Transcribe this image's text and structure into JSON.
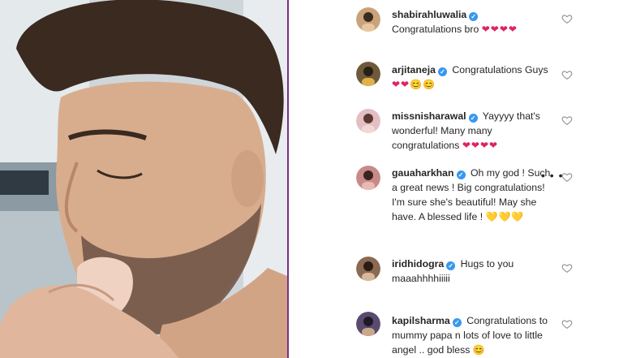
{
  "comments": [
    {
      "user": "shabirahluwalia",
      "text": "Congratulations bro",
      "emoji": "❤❤❤❤",
      "avatar_color": "#c9a37a",
      "avatar_icon": "avatar"
    },
    {
      "user": "arjitaneja",
      "text": "Congratulations Guys",
      "emoji": "❤❤😊😊",
      "avatar_color": "#6d5a3a",
      "avatar_icon": "avatar"
    },
    {
      "user": "missnisharawal",
      "text": "Yayyyy that's wonderful! Many many congratulations",
      "emoji": "❤❤❤❤",
      "avatar_color": "#e3bfc4",
      "avatar_icon": "avatar"
    },
    {
      "user": "gauaharkhan",
      "text": "Oh my god ! Such a great news ! Big congratulations! I'm sure she's beautiful! May she have. A blessed life !",
      "emoji": "💛💛💛",
      "avatar_color": "#c78a88",
      "avatar_icon": "avatar"
    },
    {
      "user": "iridhidogra",
      "text": "Hugs to you maaahhhhiiiii",
      "emoji": "",
      "avatar_color": "#8a6a52",
      "avatar_icon": "avatar"
    },
    {
      "user": "kapilsharma",
      "text": "Congratulations to mummy papa n lots of love to little angel .. god bless",
      "emoji": "😊",
      "avatar_color": "#5a4a70",
      "avatar_icon": "avatar"
    }
  ],
  "more_glyph": "• • •",
  "verified_glyph": "✓"
}
